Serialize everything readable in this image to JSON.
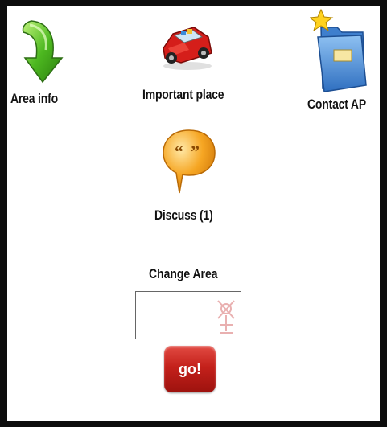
{
  "nav": {
    "area_info": "Area info",
    "important_place": "Important place",
    "contact_ap": "Contact AP",
    "discuss": "Discuss (1)"
  },
  "change_area": {
    "title": "Change Area",
    "value": "",
    "go_label": "go!"
  },
  "icons": {
    "area_info": "green-down-arrow-icon",
    "important_place": "red-car-icon",
    "contact_ap": "folder-star-icon",
    "discuss": "speech-bubble-icon",
    "input_decoration": "watermark-icon"
  },
  "colors": {
    "frame": "#0d0d0d",
    "background": "#ffffff",
    "go_button": "#c4211b"
  }
}
